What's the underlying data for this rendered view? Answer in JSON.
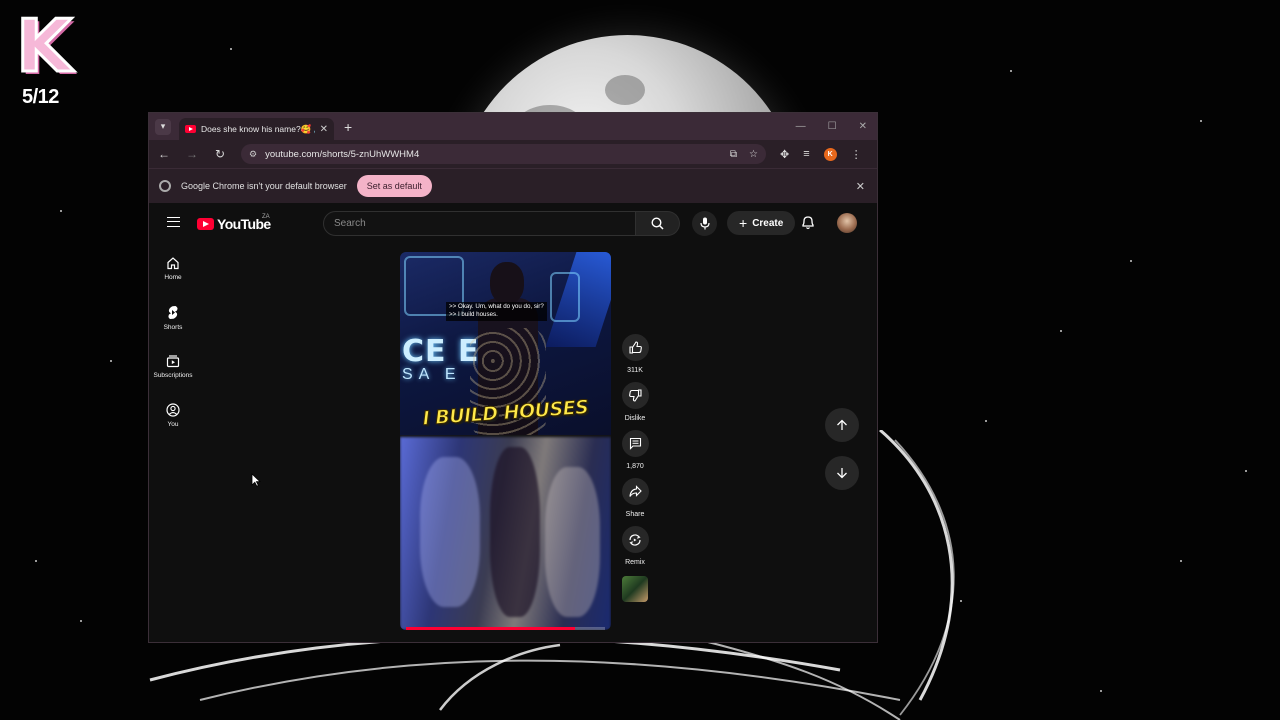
{
  "overlay": {
    "badge_letter": "K",
    "counter": "5/12"
  },
  "browser": {
    "tab": {
      "title": "Does she know his name?🥰 🔊",
      "close": "✕"
    },
    "new_tab": "+",
    "window_controls": {
      "minimize": "—",
      "maximize": "☐",
      "close": "✕"
    },
    "address": {
      "url": "youtube.com/shorts/5-znUhWWHM4"
    },
    "profile_initial": "K",
    "infobar": {
      "message": "Google Chrome isn't your default browser",
      "button": "Set as default",
      "close": "✕"
    }
  },
  "youtube": {
    "logo_text": "YouTube",
    "region": "ZA",
    "search": {
      "placeholder": "Search"
    },
    "create_label": "Create",
    "guide": [
      {
        "label": "Home",
        "icon": "home-icon"
      },
      {
        "label": "Shorts",
        "icon": "shorts-icon"
      },
      {
        "label": "Subscriptions",
        "icon": "subscriptions-icon"
      },
      {
        "label": "You",
        "icon": "you-icon"
      }
    ],
    "short": {
      "caption_line1": ">> Okay. Um, what do you do, sir?",
      "caption_line2": ">> I build houses.",
      "overlay_title": "I BUILD HOUSES",
      "neon_text": "CE  E",
      "neon_sub": "SA  E",
      "progress": 0.85
    },
    "actions": {
      "like_count": "311K",
      "dislike_label": "Dislike",
      "comment_count": "1,870",
      "share_label": "Share",
      "remix_label": "Remix"
    }
  },
  "colors": {
    "accent_red": "#ff0033",
    "default_button": "#f4b3c8",
    "title_yellow": "#ffe94a"
  }
}
